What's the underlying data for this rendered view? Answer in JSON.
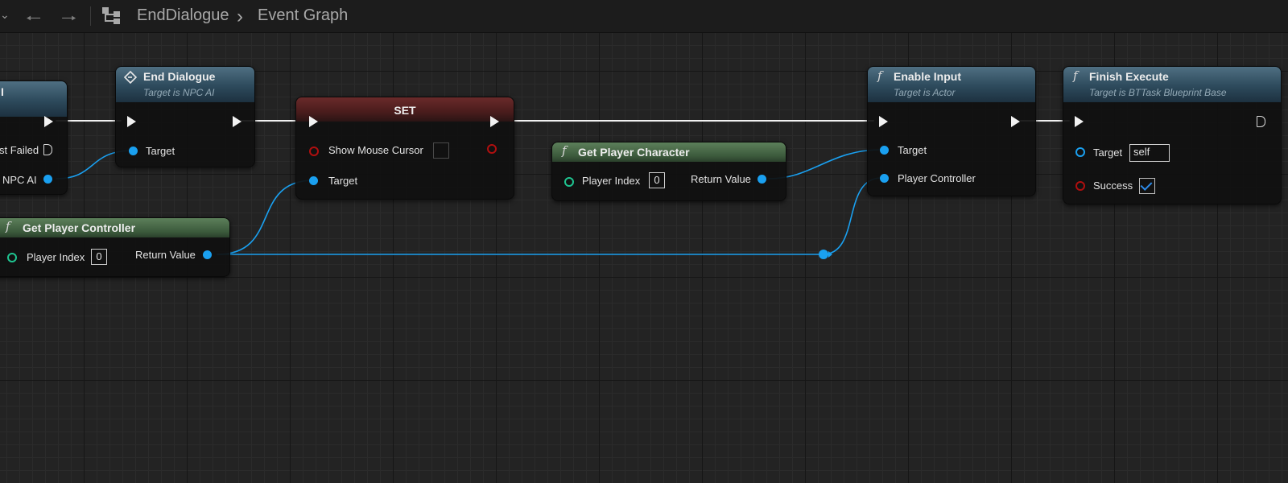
{
  "breadcrumb": {
    "asset": "EndDialogue",
    "separator": "›",
    "graph": "Event Graph"
  },
  "toolbar": {
    "back_icon": "arrow-left-icon",
    "forward_icon": "arrow-right-icon",
    "blueprint_icon": "hierarchy-icon"
  },
  "nodes": {
    "partial_left": {
      "title": "I",
      "pins": [
        "st Failed",
        "NPC AI"
      ]
    },
    "end_dialogue": {
      "title": "End Dialogue",
      "subtitle": "Target is NPC AI",
      "target_label": "Target"
    },
    "set_node": {
      "title": "SET",
      "show_mouse_cursor_label": "Show Mouse Cursor",
      "target_label": "Target",
      "checked": false
    },
    "get_player_character": {
      "icon": "f",
      "title": "Get Player Character",
      "player_index_label": "Player Index",
      "player_index_value": "0",
      "return_label": "Return Value"
    },
    "get_player_controller": {
      "icon": "f",
      "title": "Get Player Controller",
      "player_index_label": "Player Index",
      "player_index_value": "0",
      "return_label": "Return Value"
    },
    "enable_input": {
      "icon": "f",
      "title": "Enable Input",
      "subtitle": "Target is Actor",
      "target_label": "Target",
      "controller_label": "Player Controller"
    },
    "finish_execute": {
      "icon": "f",
      "title": "Finish Execute",
      "subtitle": "Target is BTTask Blueprint Base",
      "target_label": "Target",
      "target_value": "self",
      "success_label": "Success",
      "success_checked": true
    }
  },
  "colors": {
    "exec_wire": "#f2f2f2",
    "object_wire": "#1aa0f0",
    "bool_pin": "#b00f0f",
    "int_pin": "#1fc490",
    "canvas_bg": "#232323"
  }
}
